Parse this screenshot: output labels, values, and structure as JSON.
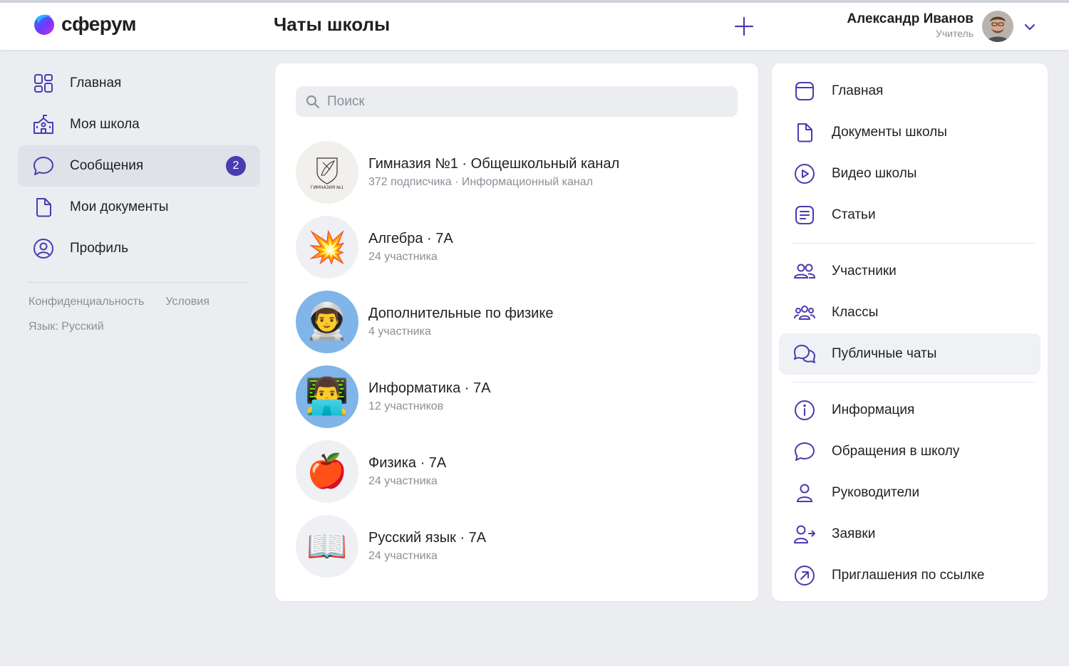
{
  "header": {
    "logo_text": "сферум",
    "page_title": "Чаты школы",
    "user_name": "Александр Иванов",
    "user_role": "Учитель"
  },
  "left_nav": {
    "items": [
      {
        "label": "Главная",
        "icon": "grid-icon"
      },
      {
        "label": "Моя школа",
        "icon": "school-icon"
      },
      {
        "label": "Сообщения",
        "icon": "message-icon",
        "badge": "2"
      },
      {
        "label": "Мои документы",
        "icon": "document-icon"
      },
      {
        "label": "Профиль",
        "icon": "profile-icon"
      }
    ],
    "footer": {
      "privacy": "Конфиденциальность",
      "terms": "Условия",
      "language": "Язык: Русский"
    }
  },
  "search": {
    "placeholder": "Поиск"
  },
  "chats": [
    {
      "title": "Гимназия №1 · Общешкольный канал",
      "subtitle": "372 подписчика · Информационный канал",
      "avatar_text": "ГИМНАЗИЯ №1"
    },
    {
      "title": "Алгебра · 7А",
      "subtitle": "24 участника",
      "avatar": "💥"
    },
    {
      "title": "Дополнительные по физике",
      "subtitle": "4 участника",
      "avatar": "👨‍🚀"
    },
    {
      "title": "Информатика · 7А",
      "subtitle": "12 участников",
      "avatar": "👨‍💻"
    },
    {
      "title": "Физика · 7А",
      "subtitle": "24 участника",
      "avatar": "🍎"
    },
    {
      "title": "Русский язык · 7А",
      "subtitle": "24 участника",
      "avatar": "📖"
    }
  ],
  "right_nav": {
    "section1": [
      {
        "label": "Главная"
      },
      {
        "label": "Документы школы"
      },
      {
        "label": "Видео школы"
      },
      {
        "label": "Статьи"
      }
    ],
    "section2": [
      {
        "label": "Участники"
      },
      {
        "label": "Классы"
      },
      {
        "label": "Публичные чаты"
      }
    ],
    "section3": [
      {
        "label": "Информация"
      },
      {
        "label": "Обращения в школу"
      },
      {
        "label": "Руководители"
      },
      {
        "label": "Заявки"
      },
      {
        "label": "Приглашения по ссылке"
      }
    ]
  },
  "colors": {
    "accent": "#4a3bb0",
    "icon": "#4a3bb0",
    "background": "#ebedf1"
  }
}
